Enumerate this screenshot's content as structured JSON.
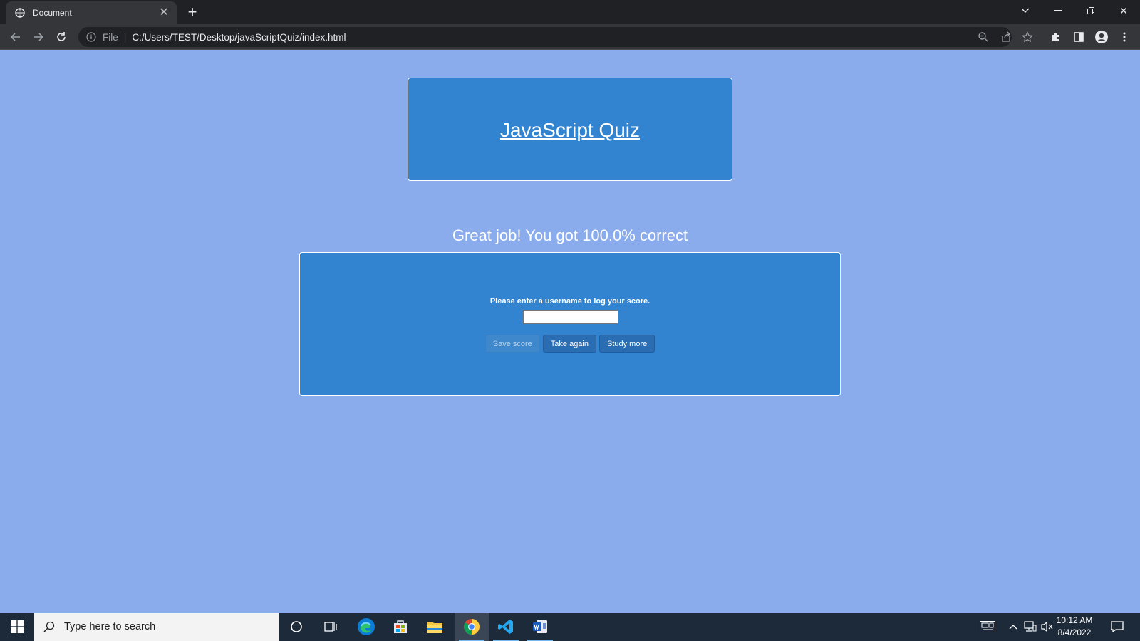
{
  "browser": {
    "tab_title": "Document",
    "address_scheme_label": "File",
    "url": "C:/Users/TEST/Desktop/javaScriptQuiz/index.html"
  },
  "page": {
    "header_title": "JavaScript Quiz",
    "result_message": "Great job! You got 100.0% correct",
    "prompt": "Please enter a username to log your score.",
    "username_value": "",
    "buttons": {
      "save_score": "Save score",
      "take_again": "Take again",
      "study_more": "Study more"
    }
  },
  "taskbar": {
    "search_placeholder": "Type here to search",
    "time": "10:12 AM",
    "date": "8/4/2022"
  },
  "colors": {
    "page_background": "#8aacec",
    "panel_blue": "#3284d1",
    "button_blue": "#2b6db3"
  }
}
